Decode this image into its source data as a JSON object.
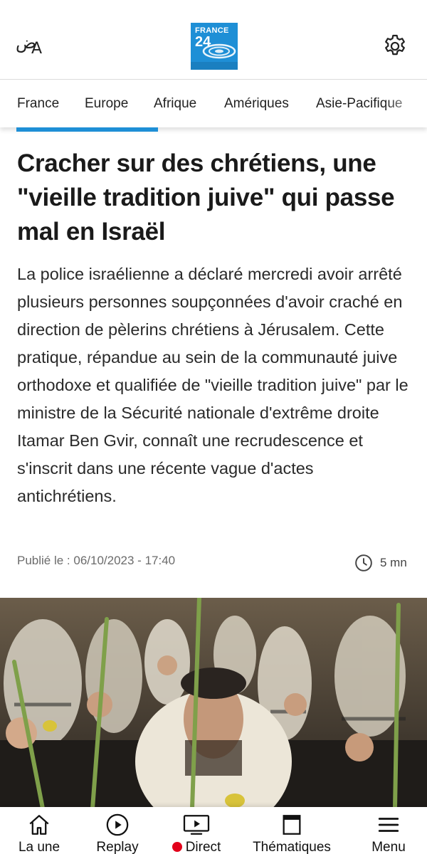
{
  "header": {
    "lang_arabic": "ض",
    "lang_latin": "A",
    "logo_line1": "FRANCE",
    "logo_line2": "24",
    "accent": "#1e8fd6"
  },
  "nav": {
    "categories": [
      "France",
      "Europe",
      "Afrique",
      "Amériques",
      "Asie-Pacifique"
    ]
  },
  "article": {
    "title": "Cracher sur des chrétiens, une \"vieille tradition juive\" qui passe mal en Israël",
    "lead": "La police israélienne a déclaré mercredi avoir arrêté plusieurs personnes soupçonnées d'avoir craché en direction de pèlerins chrétiens à Jérusalem. Cette pratique, répandue au sein de la communauté juive orthodoxe et qualifiée de \"vieille tradition juive\" par le ministre de la Sécurité nationale d'extrême droite Itamar Ben Gvir, connaît une recrudescence et s'inscrit dans une récente vague d'actes antichrétiens.",
    "published": "Publié le : 06/10/2023 - 17:40",
    "read_time": "5 mn"
  },
  "bottom_nav": {
    "home": "La une",
    "replay": "Replay",
    "direct": "Direct",
    "themes": "Thématiques",
    "menu": "Menu",
    "live_color": "#e2001a"
  },
  "icons": [
    "language-icon",
    "gear-icon",
    "clock-icon",
    "home-icon",
    "play-icon",
    "tv-icon",
    "bookmark-icon",
    "hamburger-icon"
  ]
}
